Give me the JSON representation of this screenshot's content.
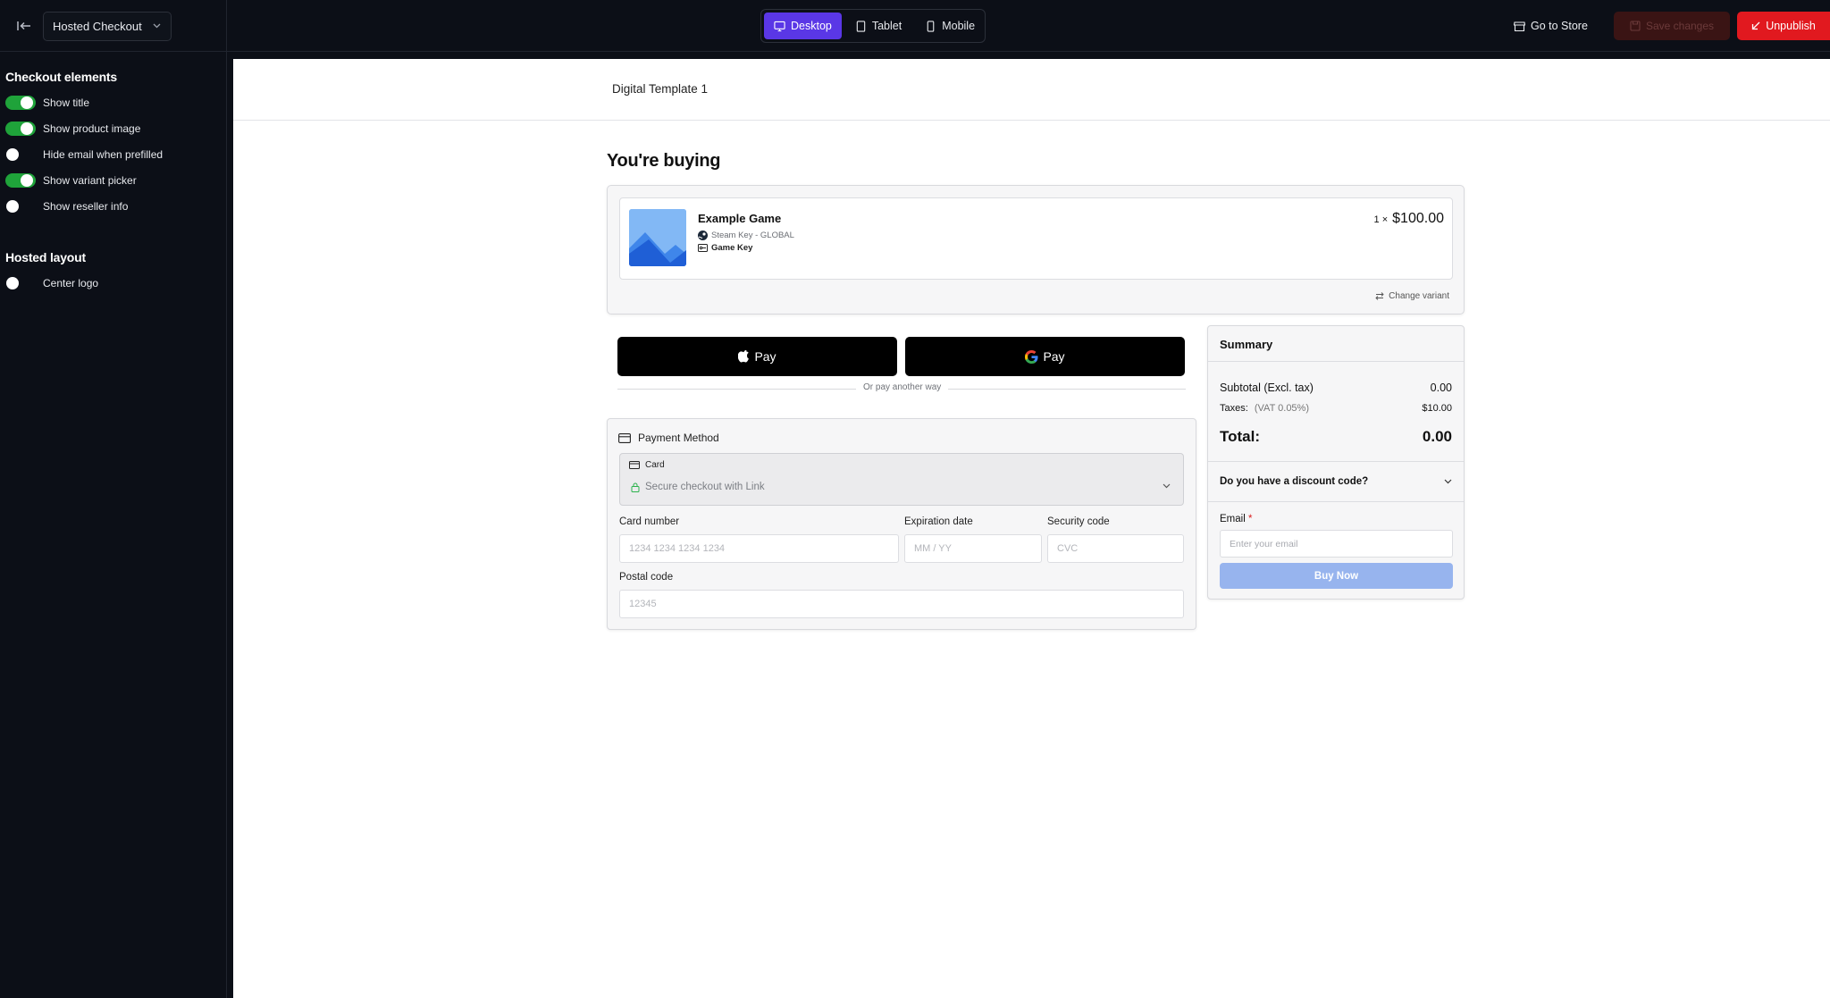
{
  "topbar": {
    "page_select": "Hosted Checkout",
    "devices": [
      {
        "label": "Desktop",
        "active": true
      },
      {
        "label": "Tablet",
        "active": false
      },
      {
        "label": "Mobile",
        "active": false
      }
    ],
    "go_to_store": "Go to Store",
    "save_changes": "Save changes",
    "unpublish": "Unpublish"
  },
  "sidebar": {
    "elements_heading": "Checkout elements",
    "elements": [
      {
        "label": "Show title",
        "on": true
      },
      {
        "label": "Show product image",
        "on": true
      },
      {
        "label": "Hide email when prefilled",
        "on": false
      },
      {
        "label": "Show variant picker",
        "on": true
      },
      {
        "label": "Show reseller info",
        "on": false
      }
    ],
    "layout_heading": "Hosted layout",
    "layout": [
      {
        "label": "Center logo",
        "on": false
      }
    ]
  },
  "preview": {
    "template_name": "Digital Template 1",
    "buying_title": "You're buying",
    "product": {
      "name": "Example Game",
      "platform": "Steam Key - GLOBAL",
      "type": "Game Key",
      "quantity": "1 ×",
      "price": "$100.00",
      "change_variant": "Change variant"
    },
    "apple_pay": "Pay",
    "google_pay": "Pay",
    "or_text": "Or pay another way",
    "payment": {
      "title": "Payment Method",
      "card_label": "Card",
      "card_link": "Secure checkout with Link",
      "card_number_label": "Card number",
      "card_number_placeholder": "1234 1234 1234 1234",
      "expiration_label": "Expiration date",
      "expiration_placeholder": "MM / YY",
      "security_label": "Security code",
      "security_placeholder": "CVC",
      "postal_label": "Postal code",
      "postal_placeholder": "12345"
    },
    "summary": {
      "title": "Summary",
      "subtotal_label": "Subtotal (Excl. tax)",
      "subtotal_value": "0.00",
      "taxes_label": "Taxes:",
      "taxes_note": "(VAT 0.05%)",
      "taxes_value": "$10.00",
      "total_label": "Total:",
      "total_value": "0.00",
      "discount_question": "Do you have a discount code?",
      "email_label": "Email",
      "email_required": "*",
      "email_placeholder": "Enter your email",
      "buy_now": "Buy Now"
    }
  }
}
